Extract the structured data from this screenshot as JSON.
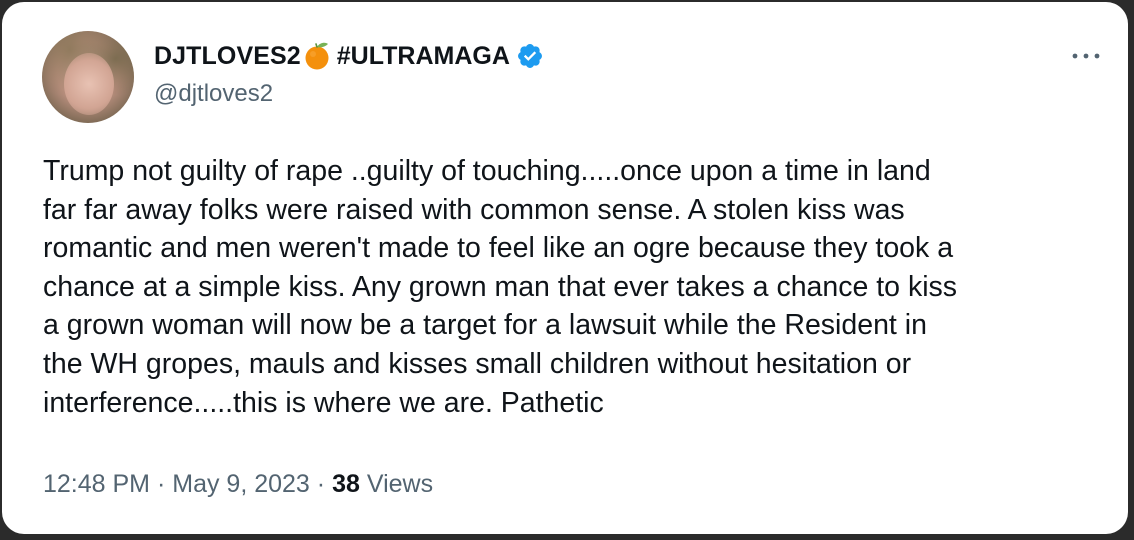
{
  "tweet": {
    "display_name": "DJTLOVES2",
    "name_emoji": "orange-icon",
    "hashtag": "#ULTRAMAGA",
    "verified": true,
    "handle": "@djtloves2",
    "text": "Trump not guilty of rape ..guilty of touching.....once upon a time in land\nfar far away folks were raised with common sense. A stolen kiss was\nromantic and men weren't made to feel like an ogre because they took a\nchance at a simple kiss. Any grown man that ever takes a chance to kiss\na grown woman will now be a target for a lawsuit while the Resident in\nthe WH gropes, mauls and kisses small children without hesitation or\ninterference.....this is where we are. Pathetic",
    "time": "12:48 PM",
    "separator": "·",
    "date": "May 9, 2023",
    "views_count": "38",
    "views_label": "Views"
  },
  "colors": {
    "text_primary": "#0f1419",
    "text_secondary": "#536471",
    "verified_blue": "#1d9bf0",
    "background": "#ffffff"
  }
}
